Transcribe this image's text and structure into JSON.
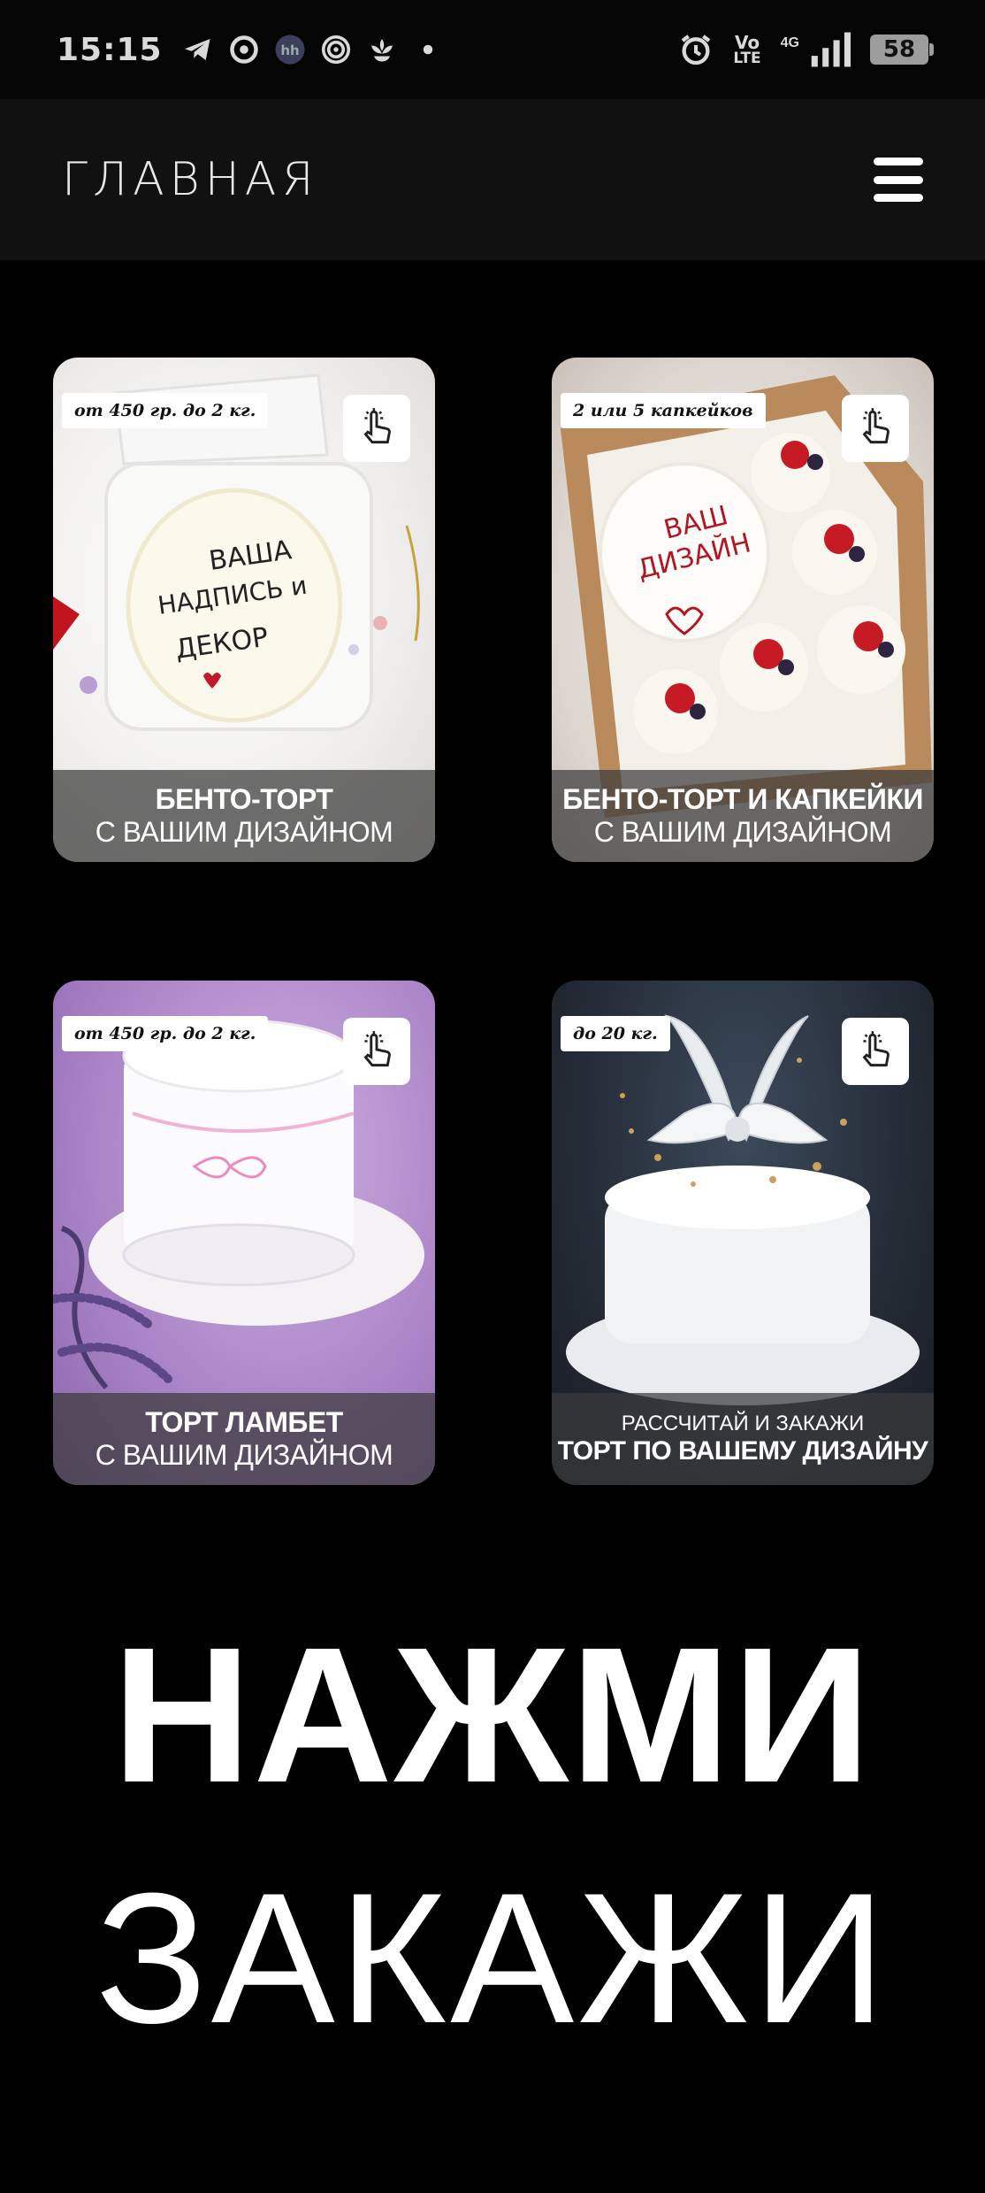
{
  "status_bar": {
    "time": "15:15",
    "left_icons": [
      "telegram-icon",
      "chrome-icon",
      "hh-icon",
      "spiral-app-icon",
      "lotus-icon",
      "notification-dot-icon"
    ],
    "alarm_icon": "alarm-icon",
    "volte_top": "Vo",
    "volte_bottom": "LTE",
    "network_type": "4G",
    "battery_level": "58"
  },
  "header": {
    "title": "ГЛАВНАЯ",
    "menu_icon": "hamburger-menu-icon"
  },
  "cards": [
    {
      "badge": "от 450 гр. до 2 кг.",
      "caption_line1": "БЕНТО-ТОРТ",
      "caption_line2": "С ВАШИМ ДИЗАЙНОМ",
      "image_text": [
        "ВАША",
        "НАДПИСЬ и",
        "ДЕКОР"
      ]
    },
    {
      "badge": "2 или 5 капкейков",
      "caption_line1": "БЕНТО-ТОРТ И КАПКЕЙКИ",
      "caption_line2": "С ВАШИМ ДИЗАЙНОМ",
      "image_text": [
        "ВАШ",
        "ДИЗАЙН"
      ]
    },
    {
      "badge": "от 450 гр. до 2 кг.",
      "caption_line1": "ТОРТ ЛАМБЕТ",
      "caption_line2": "С ВАШИМ ДИЗАЙНОМ"
    },
    {
      "badge": "до 20 кг.",
      "caption_line1": "РАССЧИТАЙ И ЗАКАЖИ",
      "caption_line2": "ТОРТ ПО ВАШЕМУ ДИЗАЙНУ"
    }
  ],
  "cta": {
    "primary": "НАЖМИ",
    "secondary": "ЗАКАЖИ"
  },
  "colors": {
    "background": "#000000",
    "header_bg": "#111111",
    "caption_overlay": "#3a3a3a",
    "text": "#ffffff"
  }
}
